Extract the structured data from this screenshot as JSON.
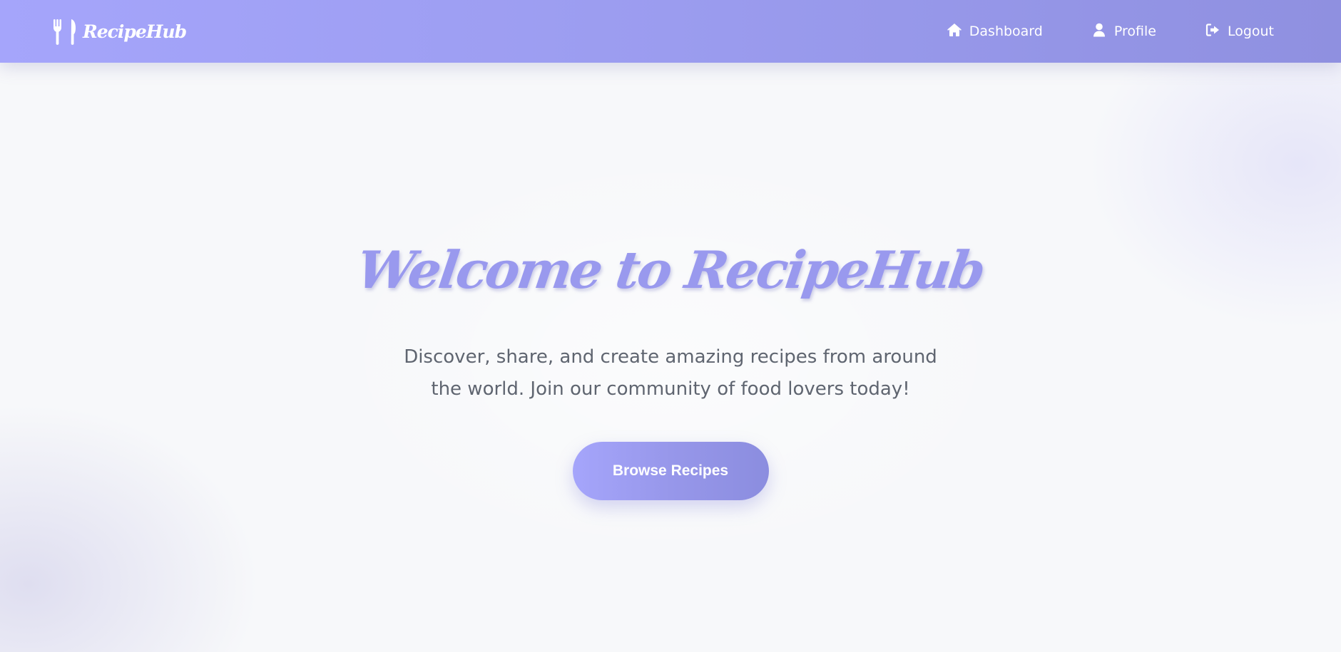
{
  "navbar": {
    "brand": {
      "icon": "utensils-icon",
      "name": "RecipeHub"
    },
    "links": [
      {
        "icon": "home-icon",
        "label": "Dashboard"
      },
      {
        "icon": "user-icon",
        "label": "Profile"
      },
      {
        "icon": "logout-icon",
        "label": "Logout"
      }
    ]
  },
  "hero": {
    "title": "Welcome to RecipeHub",
    "subtitle": "Discover, share, and create amazing recipes from around the world. Join our community of food lovers today!",
    "cta_label": "Browse Recipes"
  },
  "colors": {
    "accent_start": "#a5a5fb",
    "accent_end": "#8f90e0",
    "title": "#9999ee",
    "body_text": "#5f6570",
    "background": "#f7f8fa"
  }
}
